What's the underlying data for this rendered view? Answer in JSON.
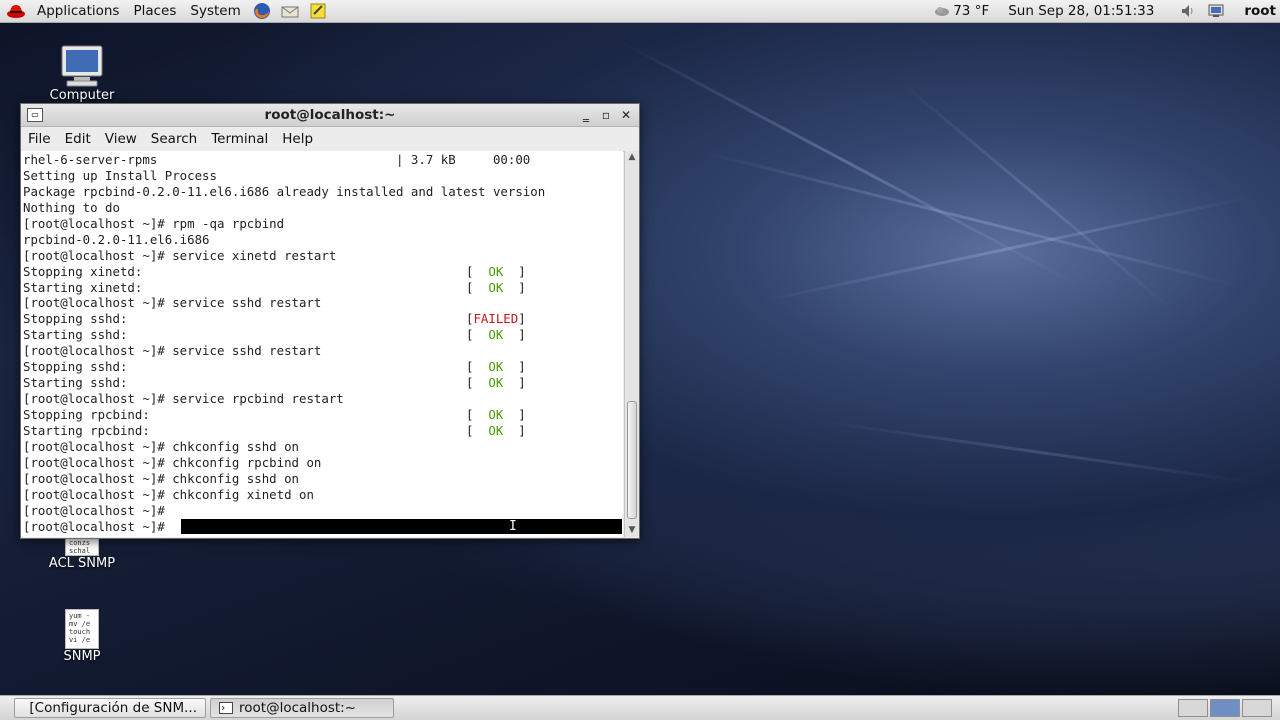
{
  "top_panel": {
    "menus": [
      "Applications",
      "Places",
      "System"
    ],
    "weather": "73 °F",
    "clock": "Sun Sep 28, 01:51:33",
    "user": "root"
  },
  "desktop_icons": {
    "computer": "Computer",
    "acl_snmp": "ACL SNMP",
    "acl_snmp_thumb": "conzs\nschal\n",
    "snmp": "SNMP",
    "snmp_thumb": "yum -\nmv /e\ntouch\nvi /e"
  },
  "window": {
    "title": "root@localhost:~",
    "menu": [
      "File",
      "Edit",
      "View",
      "Search",
      "Terminal",
      "Help"
    ]
  },
  "terminal": {
    "lines": [
      {
        "text": "rhel-6-server-rpms                                | 3.7 kB     00:00"
      },
      {
        "text": "Setting up Install Process"
      },
      {
        "text": "Package rpcbind-0.2.0-11.el6.i686 already installed and latest version"
      },
      {
        "text": "Nothing to do"
      },
      {
        "text": "[root@localhost ~]# rpm -qa rpcbind"
      },
      {
        "text": "rpcbind-0.2.0-11.el6.i686"
      },
      {
        "text": "[root@localhost ~]# service xinetd restart"
      },
      {
        "text": "Stopping xinetd:",
        "status": "OK"
      },
      {
        "text": "Starting xinetd:",
        "status": "OK"
      },
      {
        "text": "[root@localhost ~]# service sshd restart"
      },
      {
        "text": "Stopping sshd:",
        "status": "FAILED"
      },
      {
        "text": "Starting sshd:",
        "status": "OK"
      },
      {
        "text": "[root@localhost ~]# service sshd restart"
      },
      {
        "text": "Stopping sshd:",
        "status": "OK"
      },
      {
        "text": "Starting sshd:",
        "status": "OK"
      },
      {
        "text": "[root@localhost ~]# service rpcbind restart"
      },
      {
        "text": "Stopping rpcbind:",
        "status": "OK"
      },
      {
        "text": "Starting rpcbind:",
        "status": "OK"
      },
      {
        "text": "[root@localhost ~]# chkconfig sshd on"
      },
      {
        "text": "[root@localhost ~]# chkconfig rpcbind on"
      },
      {
        "text": "[root@localhost ~]# chkconfig sshd on"
      },
      {
        "text": "[root@localhost ~]# chkconfig xinetd on"
      },
      {
        "text": "[root@localhost ~]#"
      },
      {
        "text": "[root@localhost ~]#",
        "cursor": true
      }
    ]
  },
  "taskbar": {
    "items": [
      "[Configuración de SNM...",
      "root@localhost:~"
    ]
  },
  "colors": {
    "ok": "#4a9a06",
    "failed": "#c4141b"
  }
}
